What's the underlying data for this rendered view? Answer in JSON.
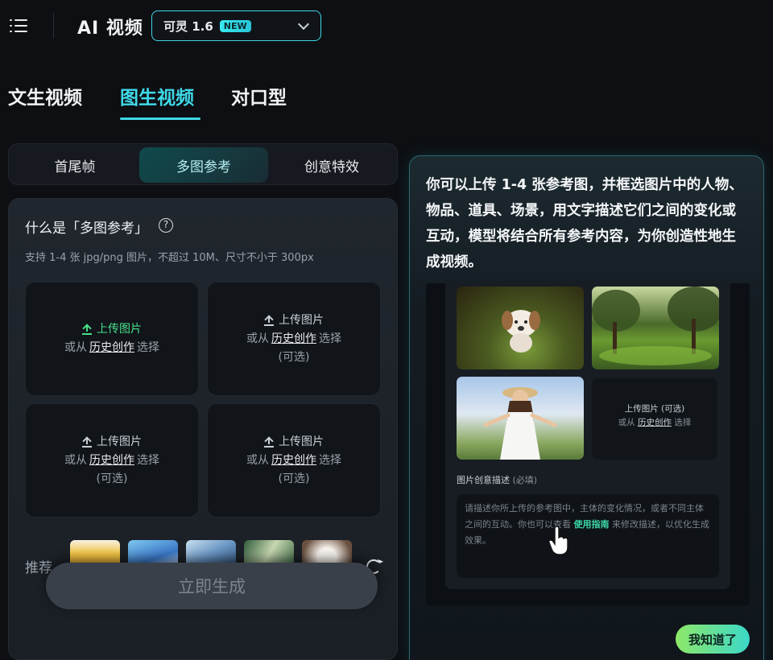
{
  "header": {
    "app_title": "AI 视频",
    "model": {
      "name": "可灵 1.6",
      "badge": "NEW"
    }
  },
  "main_tabs": [
    {
      "label": "文生视频",
      "active": false
    },
    {
      "label": "图生视频",
      "active": true
    },
    {
      "label": "对口型",
      "active": false
    }
  ],
  "sub_tabs": [
    {
      "label": "首尾帧",
      "active": false
    },
    {
      "label": "多图参考",
      "active": true
    },
    {
      "label": "创意特效",
      "active": false
    }
  ],
  "panel": {
    "title": "什么是「多图参考」",
    "subtitle": "支持 1-4 张 jpg/png 图片，不超过 10M、尺寸不小于 300px",
    "upload_cards": [
      {
        "upload": "上传图片",
        "prefix": "或从",
        "link": "历史创作",
        "suffix": "选择",
        "optional": ""
      },
      {
        "upload": "上传图片",
        "prefix": "或从",
        "link": "历史创作",
        "suffix": "选择",
        "optional": "(可选)"
      },
      {
        "upload": "上传图片",
        "prefix": "或从",
        "link": "历史创作",
        "suffix": "选择",
        "optional": "(可选)"
      },
      {
        "upload": "上传图片",
        "prefix": "或从",
        "link": "历史创作",
        "suffix": "选择",
        "optional": "(可选)"
      }
    ],
    "recommend_label": "推荐",
    "generate_label": "立即生成"
  },
  "guide": {
    "text": "你可以上传 1-4 张参考图，并框选图片中的人物、物品、道具、场景，用文字描述它们之间的变化或互动，模型将结合所有参考内容，为你创造性地生成视频。",
    "demo": {
      "upload_label": "上传图片 (可选)",
      "or_from": "或从",
      "history": "历史创作",
      "select": "选择",
      "desc_label": "图片创意描述",
      "desc_required": "(必填)",
      "placeholder_1": "请描述你所上传的参考图中，主体的变化情况，或者不同主体之间的互动。你也可以查看",
      "guide_link": "使用指南",
      "placeholder_2": "来修改描述，以优化生成效果。"
    },
    "ok_label": "我知道了"
  },
  "colors": {
    "accent": "#3fd8e8",
    "upload_green": "#49e08a",
    "ok_gradient_start": "#8ee868",
    "ok_gradient_end": "#3bd8c9"
  }
}
